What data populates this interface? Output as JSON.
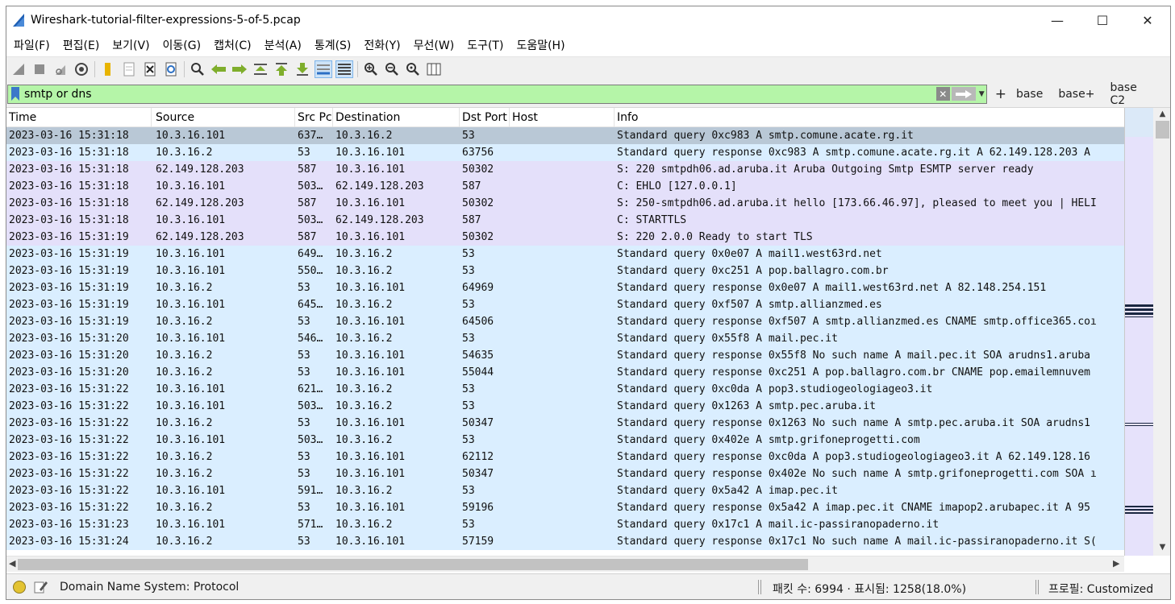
{
  "window": {
    "title": "Wireshark-tutorial-filter-expressions-5-of-5.pcap",
    "controls": {
      "minimize": "—",
      "maximize": "☐",
      "close": "✕"
    }
  },
  "menu": [
    "파일(F)",
    "편집(E)",
    "보기(V)",
    "이동(G)",
    "캡처(C)",
    "분석(A)",
    "통계(S)",
    "전화(Y)",
    "무선(W)",
    "도구(T)",
    "도움말(H)"
  ],
  "toolbar_icons": [
    "start-capture-icon",
    "stop-capture-icon",
    "restart-capture-icon",
    "capture-options-icon",
    "open-file-icon",
    "save-file-icon",
    "close-file-icon",
    "reload-file-icon",
    "find-packet-icon",
    "go-back-icon",
    "go-forward-icon",
    "go-to-packet-icon",
    "go-first-icon",
    "go-last-icon",
    "autoscroll-icon",
    "colorize-icon",
    "zoom-in-icon",
    "zoom-out-icon",
    "zoom-normal-icon",
    "resize-columns-icon"
  ],
  "filter": {
    "value": "smtp or dns",
    "buttons": [
      "+",
      "base",
      "base+",
      "base C2"
    ]
  },
  "columns": [
    "Time",
    "Source",
    "Src Pc",
    "Destination",
    "Dst Port",
    "Host",
    "Info"
  ],
  "rows": [
    {
      "time": "2023-03-16 15:31:18",
      "src": "10.3.16.101",
      "sport": "637…",
      "dst": "10.3.16.2",
      "dport": "53",
      "host": "",
      "info": "Standard query 0xc983 A smtp.comune.acate.rg.it",
      "proto": "dns",
      "selected": true
    },
    {
      "time": "2023-03-16 15:31:18",
      "src": "10.3.16.2",
      "sport": "53",
      "dst": "10.3.16.101",
      "dport": "63756",
      "host": "",
      "info": "Standard query response 0xc983 A smtp.comune.acate.rg.it A 62.149.128.203 A",
      "proto": "dns"
    },
    {
      "time": "2023-03-16 15:31:18",
      "src": "62.149.128.203",
      "sport": "587",
      "dst": "10.3.16.101",
      "dport": "50302",
      "host": "",
      "info": "S: 220 smtpdh06.ad.aruba.it Aruba Outgoing Smtp  ESMTP server ready",
      "proto": "smtp"
    },
    {
      "time": "2023-03-16 15:31:18",
      "src": "10.3.16.101",
      "sport": "503…",
      "dst": "62.149.128.203",
      "dport": "587",
      "host": "",
      "info": "C: EHLO [127.0.0.1]",
      "proto": "smtp"
    },
    {
      "time": "2023-03-16 15:31:18",
      "src": "62.149.128.203",
      "sport": "587",
      "dst": "10.3.16.101",
      "dport": "50302",
      "host": "",
      "info": "S: 250-smtpdh06.ad.aruba.it hello [173.66.46.97], pleased to meet you | HELI",
      "proto": "smtp"
    },
    {
      "time": "2023-03-16 15:31:18",
      "src": "10.3.16.101",
      "sport": "503…",
      "dst": "62.149.128.203",
      "dport": "587",
      "host": "",
      "info": "C: STARTTLS",
      "proto": "smtp"
    },
    {
      "time": "2023-03-16 15:31:19",
      "src": "62.149.128.203",
      "sport": "587",
      "dst": "10.3.16.101",
      "dport": "50302",
      "host": "",
      "info": "S: 220 2.0.0 Ready to start TLS",
      "proto": "smtp"
    },
    {
      "time": "2023-03-16 15:31:19",
      "src": "10.3.16.101",
      "sport": "649…",
      "dst": "10.3.16.2",
      "dport": "53",
      "host": "",
      "info": "Standard query 0x0e07 A mail1.west63rd.net",
      "proto": "dns"
    },
    {
      "time": "2023-03-16 15:31:19",
      "src": "10.3.16.101",
      "sport": "550…",
      "dst": "10.3.16.2",
      "dport": "53",
      "host": "",
      "info": "Standard query 0xc251 A pop.ballagro.com.br",
      "proto": "dns"
    },
    {
      "time": "2023-03-16 15:31:19",
      "src": "10.3.16.2",
      "sport": "53",
      "dst": "10.3.16.101",
      "dport": "64969",
      "host": "",
      "info": "Standard query response 0x0e07 A mail1.west63rd.net A 82.148.254.151",
      "proto": "dns"
    },
    {
      "time": "2023-03-16 15:31:19",
      "src": "10.3.16.101",
      "sport": "645…",
      "dst": "10.3.16.2",
      "dport": "53",
      "host": "",
      "info": "Standard query 0xf507 A smtp.allianzmed.es",
      "proto": "dns"
    },
    {
      "time": "2023-03-16 15:31:19",
      "src": "10.3.16.2",
      "sport": "53",
      "dst": "10.3.16.101",
      "dport": "64506",
      "host": "",
      "info": "Standard query response 0xf507 A smtp.allianzmed.es CNAME smtp.office365.coı",
      "proto": "dns"
    },
    {
      "time": "2023-03-16 15:31:20",
      "src": "10.3.16.101",
      "sport": "546…",
      "dst": "10.3.16.2",
      "dport": "53",
      "host": "",
      "info": "Standard query 0x55f8 A mail.pec.it",
      "proto": "dns"
    },
    {
      "time": "2023-03-16 15:31:20",
      "src": "10.3.16.2",
      "sport": "53",
      "dst": "10.3.16.101",
      "dport": "54635",
      "host": "",
      "info": "Standard query response 0x55f8 No such name A mail.pec.it SOA arudns1.aruba",
      "proto": "dns"
    },
    {
      "time": "2023-03-16 15:31:20",
      "src": "10.3.16.2",
      "sport": "53",
      "dst": "10.3.16.101",
      "dport": "55044",
      "host": "",
      "info": "Standard query response 0xc251 A pop.ballagro.com.br CNAME pop.emailemnuvem",
      "proto": "dns"
    },
    {
      "time": "2023-03-16 15:31:22",
      "src": "10.3.16.101",
      "sport": "621…",
      "dst": "10.3.16.2",
      "dport": "53",
      "host": "",
      "info": "Standard query 0xc0da A pop3.studiogeologiageo3.it",
      "proto": "dns"
    },
    {
      "time": "2023-03-16 15:31:22",
      "src": "10.3.16.101",
      "sport": "503…",
      "dst": "10.3.16.2",
      "dport": "53",
      "host": "",
      "info": "Standard query 0x1263 A smtp.pec.aruba.it",
      "proto": "dns"
    },
    {
      "time": "2023-03-16 15:31:22",
      "src": "10.3.16.2",
      "sport": "53",
      "dst": "10.3.16.101",
      "dport": "50347",
      "host": "",
      "info": "Standard query response 0x1263 No such name A smtp.pec.aruba.it SOA arudns1",
      "proto": "dns"
    },
    {
      "time": "2023-03-16 15:31:22",
      "src": "10.3.16.101",
      "sport": "503…",
      "dst": "10.3.16.2",
      "dport": "53",
      "host": "",
      "info": "Standard query 0x402e A smtp.grifoneprogetti.com",
      "proto": "dns"
    },
    {
      "time": "2023-03-16 15:31:22",
      "src": "10.3.16.2",
      "sport": "53",
      "dst": "10.3.16.101",
      "dport": "62112",
      "host": "",
      "info": "Standard query response 0xc0da A pop3.studiogeologiageo3.it A 62.149.128.16",
      "proto": "dns"
    },
    {
      "time": "2023-03-16 15:31:22",
      "src": "10.3.16.2",
      "sport": "53",
      "dst": "10.3.16.101",
      "dport": "50347",
      "host": "",
      "info": "Standard query response 0x402e No such name A smtp.grifoneprogetti.com SOA ı",
      "proto": "dns"
    },
    {
      "time": "2023-03-16 15:31:22",
      "src": "10.3.16.101",
      "sport": "591…",
      "dst": "10.3.16.2",
      "dport": "53",
      "host": "",
      "info": "Standard query 0x5a42 A imap.pec.it",
      "proto": "dns"
    },
    {
      "time": "2023-03-16 15:31:22",
      "src": "10.3.16.2",
      "sport": "53",
      "dst": "10.3.16.101",
      "dport": "59196",
      "host": "",
      "info": "Standard query response 0x5a42 A imap.pec.it CNAME imapop2.arubapec.it A 95",
      "proto": "dns"
    },
    {
      "time": "2023-03-16 15:31:23",
      "src": "10.3.16.101",
      "sport": "571…",
      "dst": "10.3.16.2",
      "dport": "53",
      "host": "",
      "info": "Standard query 0x17c1 A mail.ic-passiranopaderno.it",
      "proto": "dns"
    },
    {
      "time": "2023-03-16 15:31:24",
      "src": "10.3.16.2",
      "sport": "53",
      "dst": "10.3.16.101",
      "dport": "57159",
      "host": "",
      "info": "Standard query response 0x17c1 No such name A mail.ic-passiranopaderno.it S(",
      "proto": "dns"
    }
  ],
  "status": {
    "protocol": "Domain Name System: Protocol",
    "counts": "패킷 수: 6994 · 표시됨: 1258(18.0%)",
    "profile": "프로필: Customized"
  },
  "colors": {
    "filter_valid": "#b5f5a8",
    "dns_row": "#daeeff",
    "smtp_row": "#e4e0fa",
    "selected_row": "#b9c8d6"
  }
}
